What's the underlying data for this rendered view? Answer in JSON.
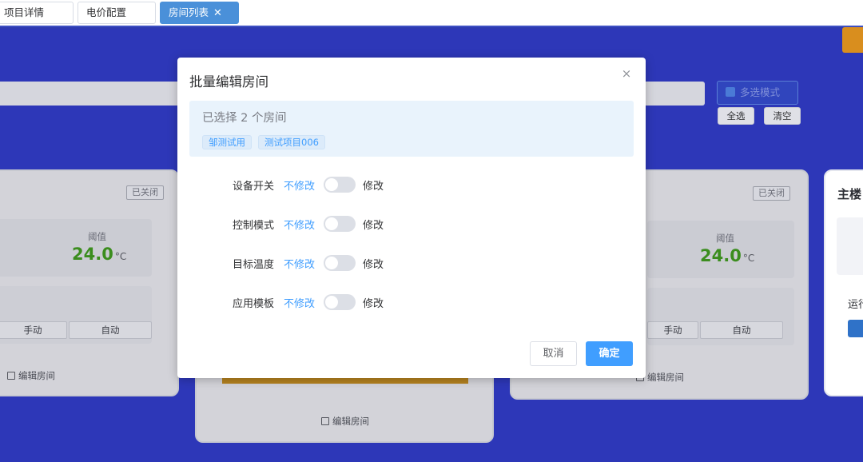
{
  "tabs": [
    {
      "label": "项目详情"
    },
    {
      "label": "电价配置"
    },
    {
      "label": "房间列表",
      "close": "✕"
    }
  ],
  "background": {
    "multi_select_label": "多选模式",
    "select_all_label": "全选",
    "clear_label": "清空",
    "cards": [
      {
        "status": "已关闭",
        "threshold_label": "阈值",
        "threshold_value": "24.0",
        "unit": "°C",
        "mode_manual": "手动",
        "mode_auto": "自动",
        "edit_label": "编辑房间"
      },
      {
        "edit_label": "编辑房间"
      },
      {
        "status": "已关闭",
        "threshold_label": "阈值",
        "threshold_value": "24.0",
        "unit": "°C",
        "mode_manual": "手动",
        "mode_auto": "自动",
        "edit_label": "编辑房间"
      },
      {
        "title": "主楼",
        "run_label": "运行"
      }
    ]
  },
  "dialog": {
    "title": "批量编辑房间",
    "close": "×",
    "selected_text": "已选择 2 个房间",
    "selected_tags": [
      "邹测试用",
      "测试项目006"
    ],
    "rows": [
      {
        "label": "设备开关",
        "off": "不修改",
        "on": "修改"
      },
      {
        "label": "控制模式",
        "off": "不修改",
        "on": "修改"
      },
      {
        "label": "目标温度",
        "off": "不修改",
        "on": "修改"
      },
      {
        "label": "应用模板",
        "off": "不修改",
        "on": "修改"
      }
    ],
    "cancel_label": "取消",
    "confirm_label": "确定"
  }
}
